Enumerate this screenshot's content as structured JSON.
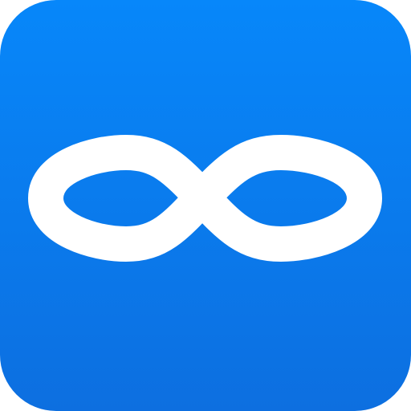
{
  "icon": {
    "name": "infinity-icon",
    "background_top": "#0787fa",
    "background_bottom": "#0d6fe0",
    "glyph_color": "#ffffff"
  }
}
